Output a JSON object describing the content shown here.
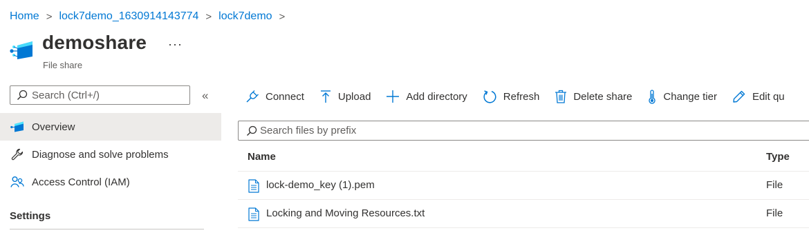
{
  "breadcrumb": {
    "items": [
      "Home",
      "lock7demo_1630914143774",
      "lock7demo"
    ],
    "separator": ">"
  },
  "resource": {
    "name": "demoshare",
    "type": "File share",
    "more_label": "···",
    "icon": "file-share-icon"
  },
  "sidebar": {
    "search_placeholder": "Search (Ctrl+/)",
    "collapse_label": "«",
    "items": [
      {
        "label": "Overview",
        "icon": "file-share-icon",
        "active": true
      },
      {
        "label": "Diagnose and solve problems",
        "icon": "wrench-icon",
        "active": false
      },
      {
        "label": "Access Control (IAM)",
        "icon": "people-icon",
        "active": false
      }
    ],
    "section_heading": "Settings"
  },
  "toolbar": {
    "connect": "Connect",
    "upload": "Upload",
    "add_directory": "Add directory",
    "refresh": "Refresh",
    "delete_share": "Delete share",
    "change_tier": "Change tier",
    "edit_quota": "Edit qu"
  },
  "files": {
    "search_placeholder": "Search files by prefix",
    "columns": {
      "name": "Name",
      "type": "Type"
    },
    "rows": [
      {
        "name": "lock-demo_key (1).pem",
        "type": "File"
      },
      {
        "name": "Locking and Moving Resources.txt",
        "type": "File"
      }
    ]
  },
  "colors": {
    "accent": "#0078d4",
    "text": "#323130",
    "muted": "#605e5c",
    "active_nav": "#edebe9",
    "border": "#8a8886"
  }
}
